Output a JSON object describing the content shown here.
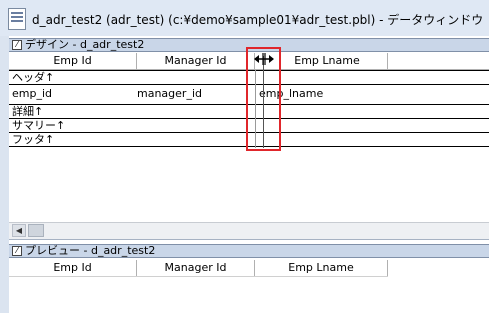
{
  "window": {
    "title": "d_adr_test2  (adr_test) (c:¥demo¥sample01¥adr_test.pbl) - データウィンドウ"
  },
  "design_pane": {
    "title": "デザイン - d_adr_test2",
    "columns": [
      "Emp Id",
      "Manager Id",
      "Emp Lname"
    ],
    "bands": {
      "header": "ヘッダ↑",
      "detail": "詳細↑",
      "summary": "サマリー↑",
      "footer": "フッタ↑"
    },
    "fields": [
      "emp_id",
      "manager_id",
      "emp_lname"
    ]
  },
  "preview_pane": {
    "title": "プレビュー - d_adr_test2",
    "columns": [
      "Emp Id",
      "Manager Id",
      "Emp Lname"
    ]
  },
  "colors": {
    "highlight": "#e0262b",
    "pane_header": "#c9d6e8"
  }
}
